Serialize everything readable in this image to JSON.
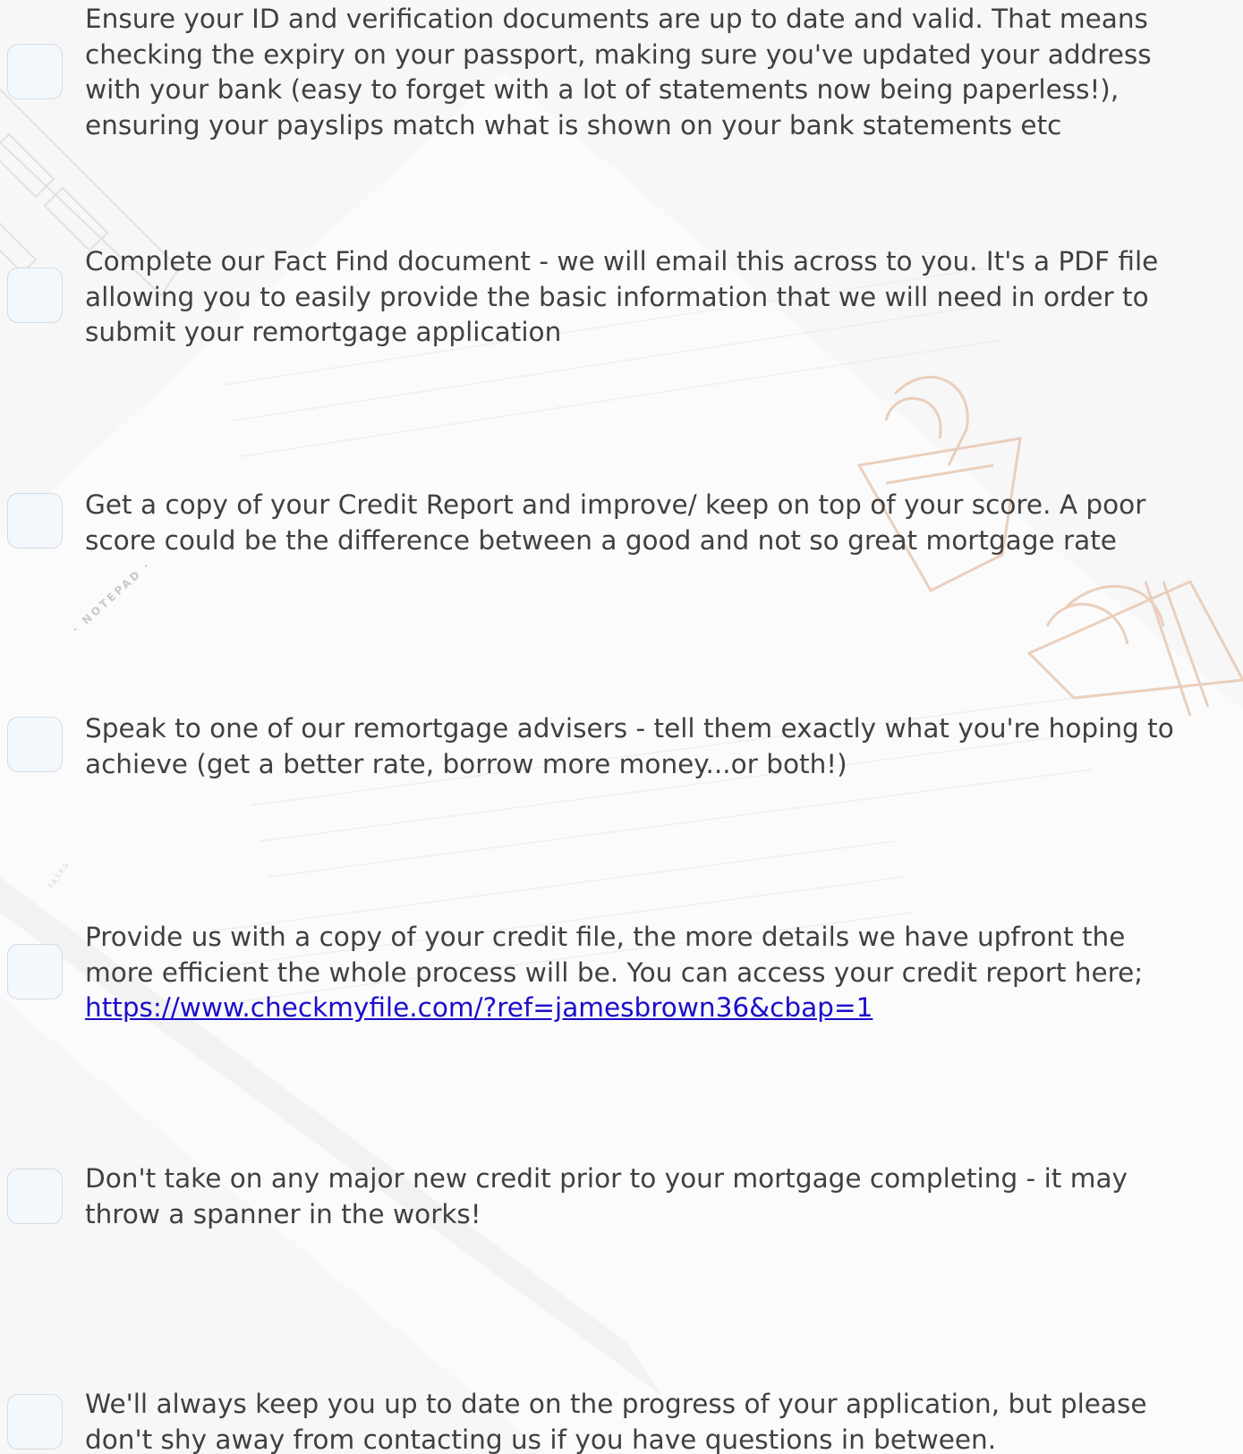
{
  "checklist": {
    "items": [
      {
        "lines": [
          "Ensure your ID and verification documents are up to date and valid. That means",
          "checking the expiry on your passport, making sure you've updated your address",
          "with your bank (easy to forget with a lot of statements now being paperless!),",
          "ensuring your payslips match what is shown on your bank statements etc"
        ],
        "checked": false
      },
      {
        "lines": [
          "Complete our Fact Find document - we will email this across to you. It's a PDF file",
          "allowing you to easily provide the basic information that we will need in order to",
          "submit your remortgage application"
        ],
        "checked": false
      },
      {
        "lines": [
          "Get a copy of your Credit Report and improve/ keep on top of your score. A poor",
          "score could be the difference between a good and not so great mortgage rate"
        ],
        "checked": false
      },
      {
        "lines": [
          "Speak to one of our remortgage advisers - tell them exactly what you're hoping to",
          "achieve (get a better rate, borrow more money...or both!)"
        ],
        "checked": false
      },
      {
        "lines": [
          "Provide us with a copy of your credit file, the more details we have upfront the",
          "more efficient the whole process will be. You can access your credit report here;"
        ],
        "link": "https://www.checkmyfile.com/?ref=jamesbrown36&cbap=1",
        "checked": false
      },
      {
        "lines": [
          "Don't take on any major new credit prior to your mortgage completing - it may",
          "throw a spanner in the works!"
        ],
        "checked": false
      },
      {
        "lines": [
          "We'll always keep you up to date on the progress of your application, but please",
          "don't shy away from contacting us if you have questions in between."
        ],
        "checked": false
      }
    ]
  },
  "background": {
    "notepad_label": "· NOTEPAD ·",
    "tasks_label": "TASKS",
    "colors": {
      "page": "#f7f7f7",
      "checkbox_fill": "#f3f8fd",
      "checkbox_border": "#d3dbe4",
      "text": "#404040",
      "link": "#1a0dcc",
      "clip_rose_gold": "#e7c3aa"
    }
  }
}
